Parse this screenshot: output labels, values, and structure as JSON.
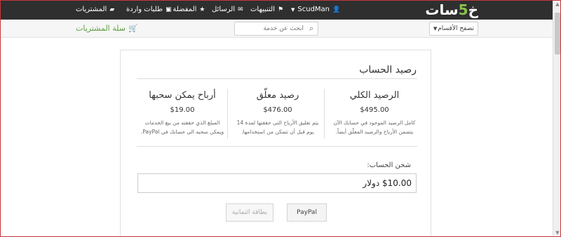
{
  "topnav": {
    "logo": {
      "part1": "خ",
      "part2": "5",
      "part3": "سات"
    },
    "user": {
      "name": "ScudMan",
      "icon": "user-icon"
    },
    "notifications": {
      "label": "التنبيهات",
      "icon": "flag-icon"
    },
    "messages": {
      "label": "الرسائل",
      "icon": "envelope-icon"
    },
    "favorites": {
      "label": "المفضلة",
      "icon": "star-icon"
    },
    "incoming_orders": {
      "label": "طلبات واردة",
      "icon": "inbox-icon"
    },
    "purchases": {
      "label": "المشتريات",
      "icon": "folder-icon"
    }
  },
  "subbar": {
    "browse": {
      "label": "تصفح الأقسام"
    },
    "search": {
      "placeholder": "ابحث عن خدمة"
    },
    "cart": {
      "label": "سلة المشتريات",
      "icon": "cart-icon"
    }
  },
  "account": {
    "title": "رصيد الحساب",
    "columns": [
      {
        "title": "الرصيد الكلي",
        "amount": "$495.00",
        "desc": "كامل الرصيد الموجود في حسابك الآن يتضمن الأرباح والرصيد المعلّق أيضاً."
      },
      {
        "title": "رصيد معلّق",
        "amount": "$476.00",
        "desc": "يتم تعليق الأرباح التى حققتها لمدة 14 يوم قبل أن تتمكن من استخدامها."
      },
      {
        "title": "أرباح يمكن سحبها",
        "amount": "$19.00",
        "desc": "المبلغ الذي حققته من بيع الخدمات ويمكن سحبه الى حسابك في PayPal."
      }
    ],
    "charge": {
      "label": "شحن الحساب:",
      "value": "$10.00 دولار"
    },
    "buttons": {
      "paypal": "PayPal",
      "credit_card": "بطاقة ائتمانية"
    }
  },
  "colors": {
    "topbar": "#2f2f2f",
    "cart_green": "#5a9e3c",
    "logo_accent": "#8bc34a"
  }
}
